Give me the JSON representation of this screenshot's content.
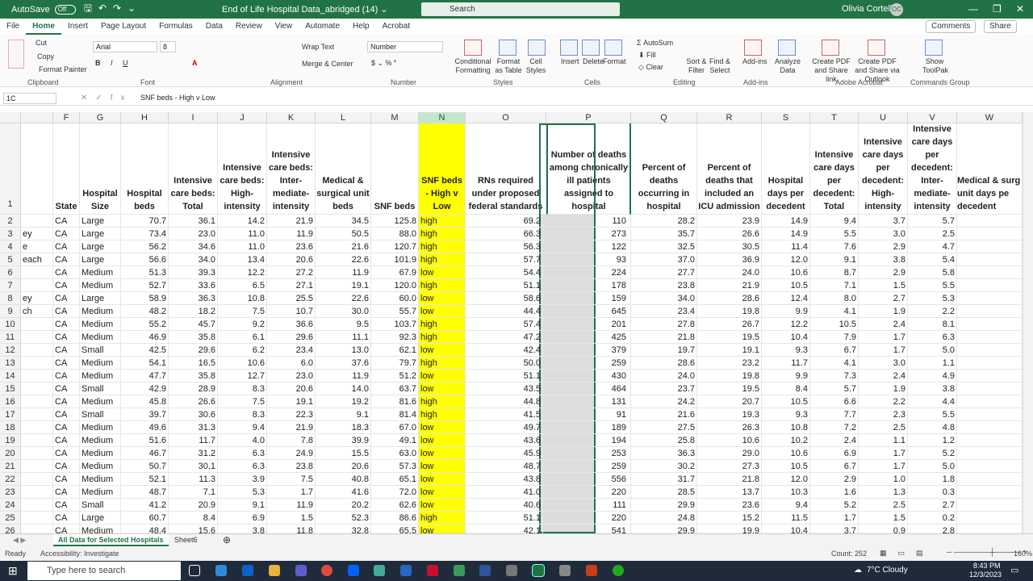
{
  "titlebar": {
    "autosave": "AutoSave",
    "autosave_state": "Off",
    "doc_title": "End of Life Hospital Data_abridged (14) ⌄",
    "search": "Search",
    "user": "Olivia Cortellini",
    "initials": "OC"
  },
  "tabs": [
    "File",
    "Home",
    "Insert",
    "Page Layout",
    "Formulas",
    "Data",
    "Review",
    "View",
    "Automate",
    "Help",
    "Acrobat"
  ],
  "active_tab": "Home",
  "comments": "Comments",
  "share": "Share",
  "ribbon": {
    "clipboard": {
      "cut": "Cut",
      "copy": "Copy",
      "format_painter": "Format Painter",
      "paste": "Paste",
      "label": "Clipboard"
    },
    "font": {
      "name": "Arial",
      "size": "8",
      "label": "Font"
    },
    "alignment": {
      "wrap": "Wrap Text",
      "merge": "Merge & Center",
      "label": "Alignment"
    },
    "number": {
      "format": "Number",
      "label": "Number"
    },
    "styles": {
      "conditional": "Conditional Formatting",
      "format_table": "Format as Table",
      "cell_styles": "Cell Styles",
      "label": "Styles"
    },
    "cells": {
      "insert": "Insert",
      "delete": "Delete",
      "format": "Format",
      "label": "Cells"
    },
    "editing": {
      "autosum": "AutoSum",
      "fill": "Fill",
      "clear": "Clear",
      "sort": "Sort & Filter",
      "find": "Find & Select",
      "label": "Editing"
    },
    "addins": {
      "addins": "Add-ins",
      "analyze": "Analyze Data",
      "label": "Add-ins"
    },
    "acrobat": {
      "pdf_share": "Create PDF and Share link",
      "pdf_outlook": "Create PDF and Share via Outlook",
      "label": "Adobe Acrobat"
    },
    "commands": {
      "toolpak": "Show ToolPak",
      "label": "Commands Group"
    }
  },
  "formula_bar": {
    "name_box": "1C",
    "content": "SNF beds - High v Low"
  },
  "columns": [
    "F",
    "G",
    "H",
    "I",
    "J",
    "K",
    "L",
    "M",
    "N",
    "O",
    "P",
    "Q",
    "R",
    "S",
    "T",
    "U",
    "V",
    "W"
  ],
  "headers": {
    "F": "State",
    "G": "Hospital Size",
    "H": "Hospital beds",
    "I": "Intensive care beds: Total",
    "J": "Intensive care beds: High-intensity",
    "K": "Intensive care beds: Inter-mediate-intensity",
    "L": "Medical & surgical unit beds",
    "M": "SNF beds",
    "N": "SNF beds - High v Low",
    "O": "RNs required under proposed federal standards",
    "P": "Number of deaths among chronically ill patients assigned to hospital",
    "Q": "Percent of deaths occurring in hospital",
    "R": "Percent of deaths that included an ICU admission",
    "S": "Hospital days per decedent",
    "T": "Intensive care days per decedent: Total",
    "U": "Intensive care days per decedent: High-intensity",
    "V": "Intensive care days per decedent: Inter-mediate-intensity",
    "W": "Medical & surg unit days pe decedent"
  },
  "row_partial_e": [
    "",
    "ey",
    "e",
    "each",
    "",
    "",
    "ey",
    "ch",
    "",
    "",
    "",
    "",
    "",
    "",
    "",
    "",
    "",
    "",
    "",
    "",
    "",
    "",
    "",
    "",
    ""
  ],
  "rows": [
    [
      "2",
      "CA",
      "Large",
      "70.7",
      "36.1",
      "14.2",
      "21.9",
      "34.5",
      "125.8",
      "high",
      "69.2",
      "110",
      "28.2",
      "23.9",
      "14.9",
      "9.4",
      "3.7",
      "5.7"
    ],
    [
      "3",
      "CA",
      "Large",
      "73.4",
      "23.0",
      "11.0",
      "11.9",
      "50.5",
      "88.0",
      "high",
      "66.3",
      "273",
      "35.7",
      "26.6",
      "14.9",
      "5.5",
      "3.0",
      "2.5"
    ],
    [
      "4",
      "CA",
      "Large",
      "56.2",
      "34.6",
      "11.0",
      "23.6",
      "21.6",
      "120.7",
      "high",
      "56.3",
      "122",
      "32.5",
      "30.5",
      "11.4",
      "7.6",
      "2.9",
      "4.7"
    ],
    [
      "5",
      "CA",
      "Large",
      "56.6",
      "34.0",
      "13.4",
      "20.6",
      "22.6",
      "101.9",
      "high",
      "57.7",
      "93",
      "37.0",
      "36.9",
      "12.0",
      "9.1",
      "3.8",
      "5.4"
    ],
    [
      "6",
      "CA",
      "Medium",
      "51.3",
      "39.3",
      "12.2",
      "27.2",
      "11.9",
      "67.9",
      "low",
      "54.4",
      "224",
      "27.7",
      "24.0",
      "10.6",
      "8.7",
      "2.9",
      "5.8"
    ],
    [
      "7",
      "CA",
      "Medium",
      "52.7",
      "33.6",
      "6.5",
      "27.1",
      "19.1",
      "120.0",
      "high",
      "51.1",
      "178",
      "23.8",
      "21.9",
      "10.5",
      "7.1",
      "1.5",
      "5.5"
    ],
    [
      "8",
      "CA",
      "Large",
      "58.9",
      "36.3",
      "10.8",
      "25.5",
      "22.6",
      "60.0",
      "low",
      "58.6",
      "159",
      "34.0",
      "28.6",
      "12.4",
      "8.0",
      "2.7",
      "5.3"
    ],
    [
      "9",
      "CA",
      "Medium",
      "48.2",
      "18.2",
      "7.5",
      "10.7",
      "30.0",
      "55.7",
      "low",
      "44.4",
      "645",
      "23.4",
      "19.8",
      "9.9",
      "4.1",
      "1.9",
      "2.2"
    ],
    [
      "10",
      "CA",
      "Medium",
      "55.2",
      "45.7",
      "9.2",
      "36.6",
      "9.5",
      "103.7",
      "high",
      "57.4",
      "201",
      "27.8",
      "26.7",
      "12.2",
      "10.5",
      "2.4",
      "8.1"
    ],
    [
      "11",
      "CA",
      "Medium",
      "46.9",
      "35.8",
      "6.1",
      "29.6",
      "11.1",
      "92.3",
      "high",
      "47.2",
      "425",
      "21.8",
      "19.5",
      "10.4",
      "7.9",
      "1.7",
      "6.3"
    ],
    [
      "12",
      "CA",
      "Small",
      "42.5",
      "29.6",
      "6.2",
      "23.4",
      "13.0",
      "62.1",
      "low",
      "42.4",
      "379",
      "19.7",
      "19.1",
      "9.3",
      "6.7",
      "1.7",
      "5.0"
    ],
    [
      "13",
      "CA",
      "Medium",
      "54.1",
      "16.5",
      "10.6",
      "6.0",
      "37.6",
      "79.7",
      "high",
      "50.0",
      "259",
      "28.6",
      "23.2",
      "11.7",
      "4.1",
      "3.0",
      "1.1"
    ],
    [
      "14",
      "CA",
      "Medium",
      "47.7",
      "35.8",
      "12.7",
      "23.0",
      "11.9",
      "51.2",
      "low",
      "51.1",
      "430",
      "24.0",
      "19.8",
      "9.9",
      "7.3",
      "2.4",
      "4.9"
    ],
    [
      "15",
      "CA",
      "Small",
      "42.9",
      "28.9",
      "8.3",
      "20.6",
      "14.0",
      "63.7",
      "low",
      "43.5",
      "464",
      "23.7",
      "19.5",
      "8.4",
      "5.7",
      "1.9",
      "3.8"
    ],
    [
      "16",
      "CA",
      "Medium",
      "45.8",
      "26.6",
      "7.5",
      "19.1",
      "19.2",
      "81.6",
      "high",
      "44.8",
      "131",
      "24.2",
      "20.7",
      "10.5",
      "6.6",
      "2.2",
      "4.4"
    ],
    [
      "17",
      "CA",
      "Small",
      "39.7",
      "30.6",
      "8.3",
      "22.3",
      "9.1",
      "81.4",
      "high",
      "41.5",
      "91",
      "21.6",
      "19.3",
      "9.3",
      "7.7",
      "2.3",
      "5.5"
    ],
    [
      "18",
      "CA",
      "Medium",
      "49.6",
      "31.3",
      "9.4",
      "21.9",
      "18.3",
      "67.0",
      "low",
      "49.7",
      "189",
      "27.5",
      "26.3",
      "10.8",
      "7.2",
      "2.5",
      "4.8"
    ],
    [
      "19",
      "CA",
      "Medium",
      "51.6",
      "11.7",
      "4.0",
      "7.8",
      "39.9",
      "49.1",
      "low",
      "43.6",
      "194",
      "25.8",
      "10.6",
      "10.2",
      "2.4",
      "1.1",
      "1.2"
    ],
    [
      "20",
      "CA",
      "Medium",
      "46.7",
      "31.2",
      "6.3",
      "24.9",
      "15.5",
      "63.0",
      "low",
      "45.9",
      "253",
      "36.3",
      "29.0",
      "10.6",
      "6.9",
      "1.7",
      "5.2"
    ],
    [
      "21",
      "CA",
      "Medium",
      "50.7",
      "30.1",
      "6.3",
      "23.8",
      "20.6",
      "57.3",
      "low",
      "48.7",
      "259",
      "30.2",
      "27.3",
      "10.5",
      "6.7",
      "1.7",
      "5.0"
    ],
    [
      "22",
      "CA",
      "Medium",
      "52.1",
      "11.3",
      "3.9",
      "7.5",
      "40.8",
      "65.1",
      "low",
      "43.8",
      "556",
      "31.7",
      "21.8",
      "12.0",
      "2.9",
      "1.0",
      "1.8"
    ],
    [
      "23",
      "CA",
      "Medium",
      "48.7",
      "7.1",
      "5.3",
      "1.7",
      "41.6",
      "72.0",
      "low",
      "41.0",
      "220",
      "28.5",
      "13.7",
      "10.3",
      "1.6",
      "1.3",
      "0.3"
    ],
    [
      "24",
      "CA",
      "Small",
      "41.2",
      "20.9",
      "9.1",
      "11.9",
      "20.2",
      "62.6",
      "low",
      "40.6",
      "111",
      "29.9",
      "23.6",
      "9.4",
      "5.2",
      "2.5",
      "2.7"
    ],
    [
      "25",
      "CA",
      "Large",
      "60.7",
      "8.4",
      "6.9",
      "1.5",
      "52.3",
      "86.6",
      "high",
      "51.1",
      "220",
      "24.8",
      "15.2",
      "11.5",
      "1.7",
      "1.5",
      "0.2"
    ],
    [
      "26",
      "CA",
      "Medium",
      "48.4",
      "15.6",
      "3.8",
      "11.8",
      "32.8",
      "65.5",
      "low",
      "42.1",
      "541",
      "29.9",
      "19.9",
      "10.4",
      "3.7",
      "0.9",
      "2.8"
    ]
  ],
  "sheet_tabs": [
    "All Data for Selected Hospitals",
    "Sheet6"
  ],
  "active_sheet": "All Data for Selected Hospitals",
  "status": {
    "ready": "Ready",
    "accessibility": "Accessibility: Investigate",
    "count": "Count: 252",
    "zoom": "160%"
  },
  "taskbar": {
    "search": "Type here to search",
    "weather": "7°C  Cloudy",
    "time": "8:43 PM",
    "date": "12/3/2023"
  }
}
